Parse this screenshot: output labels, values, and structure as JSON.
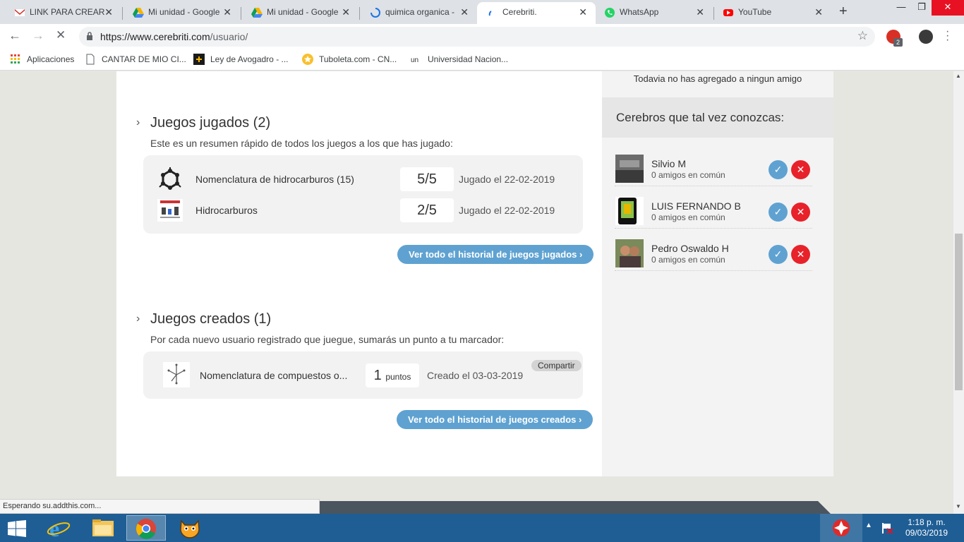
{
  "browser": {
    "tabs": [
      {
        "title": "LINK PARA CREAR",
        "favicon": "gmail-icon",
        "color": "#d93025"
      },
      {
        "title": "Mi unidad - Google",
        "favicon": "drive-icon",
        "color": "#f4b400"
      },
      {
        "title": "Mi unidad - Google",
        "favicon": "drive-icon",
        "color": "#f4b400"
      },
      {
        "title": "quimica organica -",
        "favicon": "loading-icon",
        "color": "#1a73e8"
      },
      {
        "title": "Cerebriti.",
        "favicon": "loading-icon",
        "color": "#1a73e8"
      },
      {
        "title": "WhatsApp",
        "favicon": "whatsapp-icon",
        "color": "#25d366"
      },
      {
        "title": "YouTube",
        "favicon": "youtube-icon",
        "color": "#ff0000"
      }
    ],
    "url_host": "https://www.cerebriti.com",
    "url_path": "/usuario/",
    "extension_badge": "2",
    "bookmarks": [
      {
        "label": "Aplicaciones",
        "icon": "apps-grid-icon"
      },
      {
        "label": "CANTAR DE MIO CI...",
        "icon": "page-icon"
      },
      {
        "label": "Ley de Avogadro - ...",
        "icon": "site-icon"
      },
      {
        "label": "Tuboleta.com - CN...",
        "icon": "star-site-icon"
      },
      {
        "label": "Universidad Nacion...",
        "icon": "un-icon"
      }
    ]
  },
  "played": {
    "title": "Juegos jugados (2)",
    "description": "Este es un resumen rápido de todos los juegos a los que has jugado:",
    "games": [
      {
        "name": "Nomenclatura de hidrocarburos (15)",
        "score": "5/5",
        "date": "Jugado el 22-02-2019"
      },
      {
        "name": "Hidrocarburos",
        "score": "2/5",
        "date": "Jugado el 22-02-2019"
      }
    ],
    "history_button": "Ver todo el historial de juegos jugados"
  },
  "created": {
    "title": "Juegos creados (1)",
    "description": "Por cada nuevo usuario registrado que juegue, sumarás un punto a tu marcador:",
    "games": [
      {
        "name": "Nomenclatura de compuestos o...",
        "points": "1",
        "points_label": "puntos",
        "date": "Creado el 03-03-2019",
        "share": "Compartir"
      }
    ],
    "history_button": "Ver todo el historial de juegos creados"
  },
  "sidebar": {
    "no_friends": "Todavia no has agregado a ningun amigo",
    "suggest_title": "Cerebros que tal vez conozcas:",
    "people": [
      {
        "name": "Silvio M",
        "mutual": "0 amigos en común"
      },
      {
        "name": "LUIS FERNANDO B",
        "mutual": "0 amigos en común"
      },
      {
        "name": "Pedro Oswaldo H",
        "mutual": "0 amigos en común"
      }
    ]
  },
  "status_text": "Esperando su.addthis.com...",
  "clock": {
    "time": "1:18 p. m.",
    "date": "09/03/2019"
  },
  "colors": {
    "accent": "#5fa2d1",
    "reject": "#e8222a",
    "taskbar": "#1f5e95"
  }
}
